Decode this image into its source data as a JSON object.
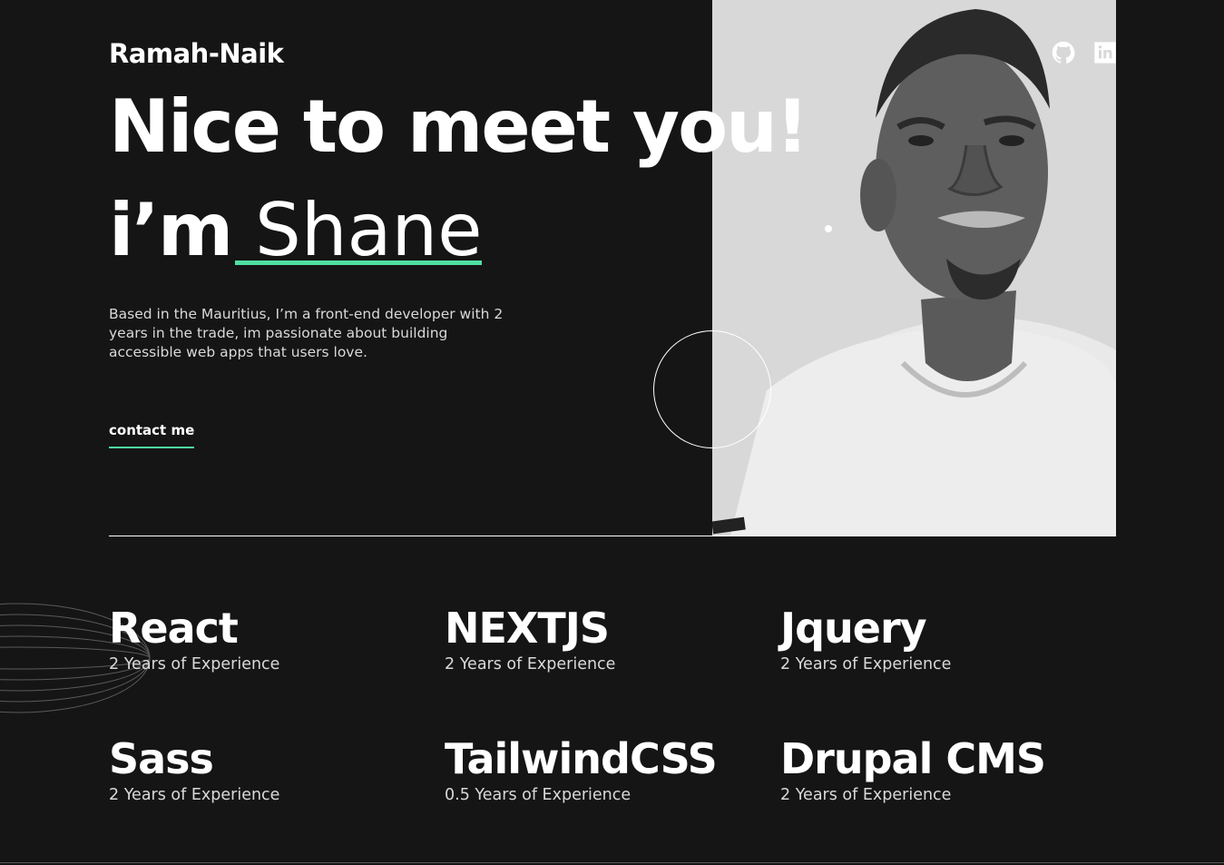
{
  "header": {
    "brand": "Ramah-Naik",
    "social": [
      {
        "name": "github-icon"
      },
      {
        "name": "linkedin-icon"
      }
    ]
  },
  "hero": {
    "title_line1": "Nice to meet you!",
    "title_prefix": "i’m",
    "title_name": "Shane",
    "intro": "Based in the Mauritius, I’m a front-end developer with 2 years in the trade, im passionate about building accessible web apps that users love.",
    "cta_label": "contact me"
  },
  "skills": [
    {
      "name": "React",
      "experience": "2 Years of Experience"
    },
    {
      "name": "NEXTJS",
      "experience": "2 Years of Experience"
    },
    {
      "name": "Jquery",
      "experience": "2 Years of Experience"
    },
    {
      "name": "Sass",
      "experience": "2 Years of Experience"
    },
    {
      "name": "TailwindCSS",
      "experience": "0.5 Years of Experience"
    },
    {
      "name": "Drupal CMS",
      "experience": "2 Years of Experience"
    }
  ],
  "colors": {
    "background": "#151515",
    "accent": "#4ee1a0",
    "text": "#ffffff",
    "muted": "#d9d9d9"
  }
}
